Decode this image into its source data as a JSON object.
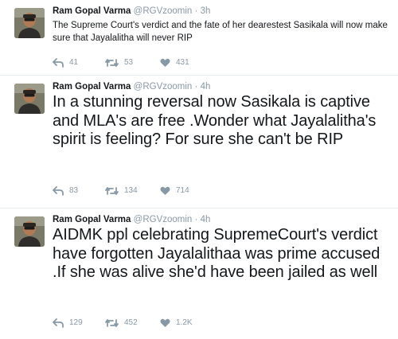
{
  "tweets": [
    {
      "author_name": "Ram Gopal Varma",
      "handle": "@RGVzoomin",
      "separator": "·",
      "time": "3h",
      "text": "The Supreme Court's verdict and the fate of her dearestest Sasikala will now make sure that Jayalalitha will never RIP",
      "replies": "41",
      "retweets": "53",
      "likes": "431"
    },
    {
      "author_name": "Ram Gopal Varma",
      "handle": "@RGVzoomin",
      "separator": "·",
      "time": "4h",
      "text": "In a stunning reversal now Sasikala is captive and MLA's are free  .Wonder what Jayalalitha's spirit is feeling? For sure she can't be RIP",
      "replies": "83",
      "retweets": "134",
      "likes": "714"
    },
    {
      "author_name": "Ram Gopal Varma",
      "handle": "@RGVzoomin",
      "separator": "·",
      "time": "4h",
      "text": "AIDMK ppl celebrating SupremeCourt's verdict have forgotten Jayalalithaa was prime accused .If she was alive she'd have been jailed as well",
      "replies": "129",
      "retweets": "452",
      "likes": "1.2K"
    }
  ],
  "colors": {
    "text": "#14171a",
    "muted": "#8899a6",
    "divider": "#e6ecf0",
    "background": "#ffffff"
  },
  "icons": [
    "avatar",
    "reply-icon",
    "retweet-icon",
    "like-icon"
  ]
}
